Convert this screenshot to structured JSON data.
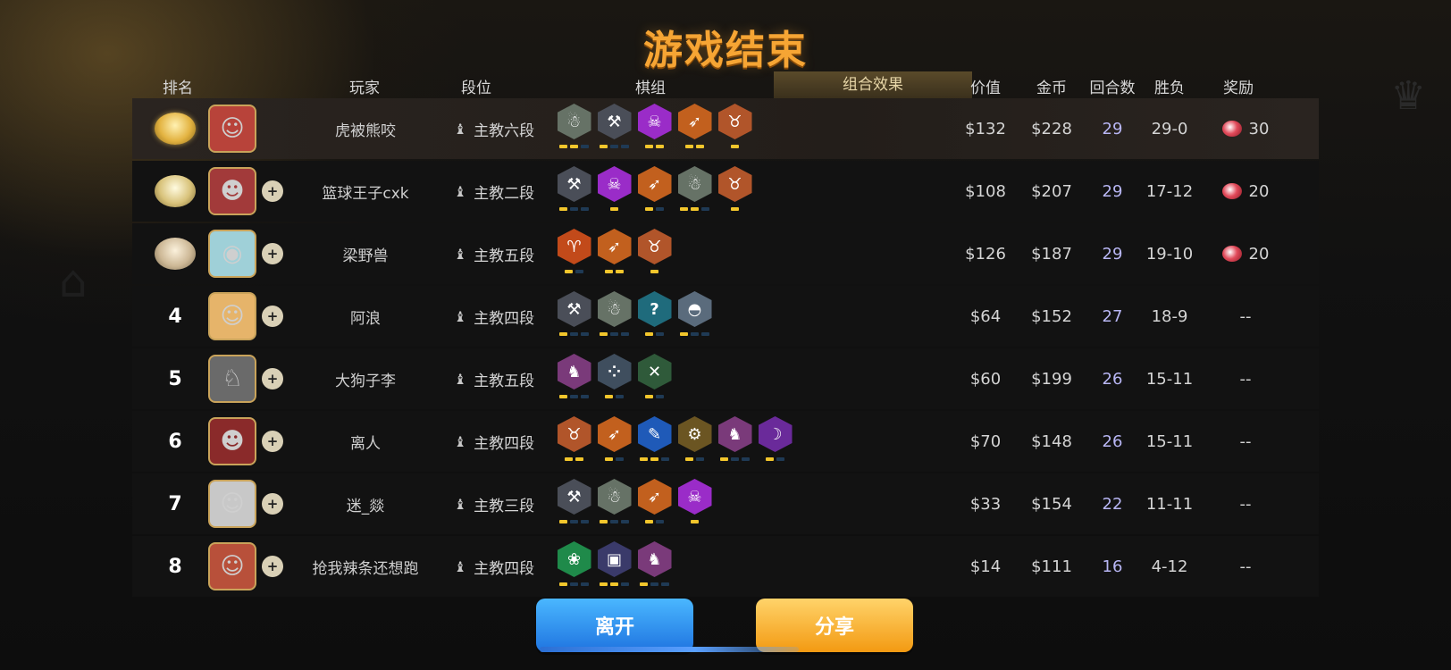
{
  "title": "游戏结束",
  "headers": {
    "rank": "排名",
    "player": "玩家",
    "tier": "段位",
    "lineup": "棋组",
    "combo": "组合效果",
    "value": "价值",
    "gold": "金币",
    "rounds": "回合数",
    "wl": "胜负",
    "reward": "奖励"
  },
  "colors": {
    "accent_orange": "#f6a534",
    "pip_on": "#f2c62c",
    "pip_off": "#1f3a55",
    "rounds_text": "#b8b6f4",
    "leave_button": "#2b8cf0",
    "share_button": "#f7b23a"
  },
  "rows": [
    {
      "rank": "",
      "medal": "gold-medal",
      "avatar": "player-portrait",
      "add_friend": false,
      "name": "虎被熊咬",
      "tier": "主教六段",
      "value": "$132",
      "gold": "$228",
      "rounds": "29",
      "wl": "29-0",
      "reward": "30",
      "reward_icon": "candy-icon",
      "traits": [
        {
          "icon": "yeti-icon",
          "color": "#667266",
          "pips": [
            true,
            true,
            false
          ]
        },
        {
          "icon": "axe-icon",
          "color": "#4a4e58",
          "pips": [
            true,
            false,
            false
          ]
        },
        {
          "icon": "demon-icon",
          "color": "#9a2cc8",
          "pips": [
            true,
            true
          ]
        },
        {
          "icon": "feather-icon",
          "color": "#c2601e",
          "pips": [
            true,
            true
          ]
        },
        {
          "icon": "minotaur-icon",
          "color": "#b1552a",
          "pips": [
            true
          ]
        }
      ]
    },
    {
      "rank": "",
      "medal": "silver-medal",
      "avatar": "panda-portrait",
      "add_friend": true,
      "name": "篮球王子cxk",
      "tier": "主教二段",
      "value": "$108",
      "gold": "$207",
      "rounds": "29",
      "wl": "17-12",
      "reward": "20",
      "reward_icon": "candy-icon",
      "traits": [
        {
          "icon": "axe-icon",
          "color": "#4a4e58",
          "pips": [
            true,
            false,
            false
          ]
        },
        {
          "icon": "demon-icon",
          "color": "#9a2cc8",
          "pips": [
            true
          ]
        },
        {
          "icon": "feather-icon",
          "color": "#c2601e",
          "pips": [
            true,
            false
          ]
        },
        {
          "icon": "yeti-icon",
          "color": "#667266",
          "pips": [
            true,
            true,
            false
          ]
        },
        {
          "icon": "minotaur-icon",
          "color": "#b1552a",
          "pips": [
            true
          ]
        }
      ]
    },
    {
      "rank": "",
      "medal": "bronze-medal",
      "avatar": "raccoon-portrait",
      "add_friend": true,
      "name": "梁野兽",
      "tier": "主教五段",
      "value": "$126",
      "gold": "$187",
      "rounds": "29",
      "wl": "19-10",
      "reward": "20",
      "reward_icon": "candy-icon",
      "traits": [
        {
          "icon": "horned-beast-icon",
          "color": "#c24a1a",
          "pips": [
            true,
            false
          ]
        },
        {
          "icon": "feather-icon",
          "color": "#c2601e",
          "pips": [
            true,
            true
          ]
        },
        {
          "icon": "minotaur-icon",
          "color": "#b1552a",
          "pips": [
            true
          ]
        }
      ]
    },
    {
      "rank": "4",
      "medal": "",
      "avatar": "girl-portrait",
      "add_friend": true,
      "name": "阿浪",
      "tier": "主教四段",
      "value": "$64",
      "gold": "$152",
      "rounds": "27",
      "wl": "18-9",
      "reward": "--",
      "reward_icon": "",
      "traits": [
        {
          "icon": "axe-icon",
          "color": "#4a4e58",
          "pips": [
            true,
            false,
            false
          ]
        },
        {
          "icon": "yeti-icon",
          "color": "#667266",
          "pips": [
            true,
            false,
            false
          ]
        },
        {
          "icon": "question-icon",
          "color": "#1f6b7c",
          "pips": [
            true,
            false
          ]
        },
        {
          "icon": "helmet-icon",
          "color": "#5a6b7c",
          "pips": [
            true,
            false,
            false
          ]
        }
      ]
    },
    {
      "rank": "5",
      "medal": "",
      "avatar": "dragon-portrait",
      "add_friend": true,
      "name": "大狗子李",
      "tier": "主教五段",
      "value": "$60",
      "gold": "$199",
      "rounds": "26",
      "wl": "15-11",
      "reward": "--",
      "reward_icon": "",
      "traits": [
        {
          "icon": "knight-icon",
          "color": "#7a3a7a",
          "pips": [
            true,
            false,
            false
          ]
        },
        {
          "icon": "pawprint-cluster-icon",
          "color": "#3f4e5e",
          "pips": [
            true,
            false
          ]
        },
        {
          "icon": "crossbow-icon",
          "color": "#2f5a3a",
          "pips": [
            true,
            false
          ]
        }
      ]
    },
    {
      "rank": "6",
      "medal": "",
      "avatar": "bandit-portrait",
      "add_friend": true,
      "name": "离人",
      "tier": "主教四段",
      "value": "$70",
      "gold": "$148",
      "rounds": "26",
      "wl": "15-11",
      "reward": "--",
      "reward_icon": "",
      "traits": [
        {
          "icon": "minotaur-icon",
          "color": "#b1552a",
          "pips": [
            true,
            true
          ]
        },
        {
          "icon": "feather-icon",
          "color": "#c2601e",
          "pips": [
            true,
            false
          ]
        },
        {
          "icon": "dagger-icon",
          "color": "#1f5ab8",
          "pips": [
            true,
            true,
            false
          ]
        },
        {
          "icon": "gear-icon",
          "color": "#6b5522",
          "pips": [
            true,
            false
          ]
        },
        {
          "icon": "knight-icon",
          "color": "#7a3a7a",
          "pips": [
            true,
            false,
            false
          ]
        },
        {
          "icon": "assassin-icon",
          "color": "#6a2a9a",
          "pips": [
            true,
            false
          ]
        }
      ]
    },
    {
      "rank": "7",
      "medal": "",
      "avatar": "witch-portrait",
      "add_friend": true,
      "name": "迷_燚",
      "tier": "主教三段",
      "value": "$33",
      "gold": "$154",
      "rounds": "22",
      "wl": "11-11",
      "reward": "--",
      "reward_icon": "",
      "traits": [
        {
          "icon": "axe-icon",
          "color": "#4a4e58",
          "pips": [
            true,
            false,
            false
          ]
        },
        {
          "icon": "yeti-icon",
          "color": "#667266",
          "pips": [
            true,
            false,
            false
          ]
        },
        {
          "icon": "feather-icon",
          "color": "#c2601e",
          "pips": [
            true,
            false
          ]
        },
        {
          "icon": "demon-icon",
          "color": "#9a2cc8",
          "pips": [
            true
          ]
        }
      ]
    },
    {
      "rank": "8",
      "medal": "",
      "avatar": "boy-portrait",
      "add_friend": true,
      "name": "抢我辣条还想跑",
      "tier": "主教四段",
      "value": "$14",
      "gold": "$111",
      "rounds": "16",
      "wl": "4-12",
      "reward": "--",
      "reward_icon": "",
      "traits": [
        {
          "icon": "paw-icon",
          "color": "#1f8a4a",
          "pips": [
            true,
            false,
            false
          ]
        },
        {
          "icon": "mech-icon",
          "color": "#3a3a6a",
          "pips": [
            true,
            true,
            false
          ]
        },
        {
          "icon": "knight-icon",
          "color": "#7a3a7a",
          "pips": [
            true,
            false,
            false
          ]
        }
      ]
    }
  ],
  "buttons": {
    "leave": "离开",
    "share": "分享"
  }
}
